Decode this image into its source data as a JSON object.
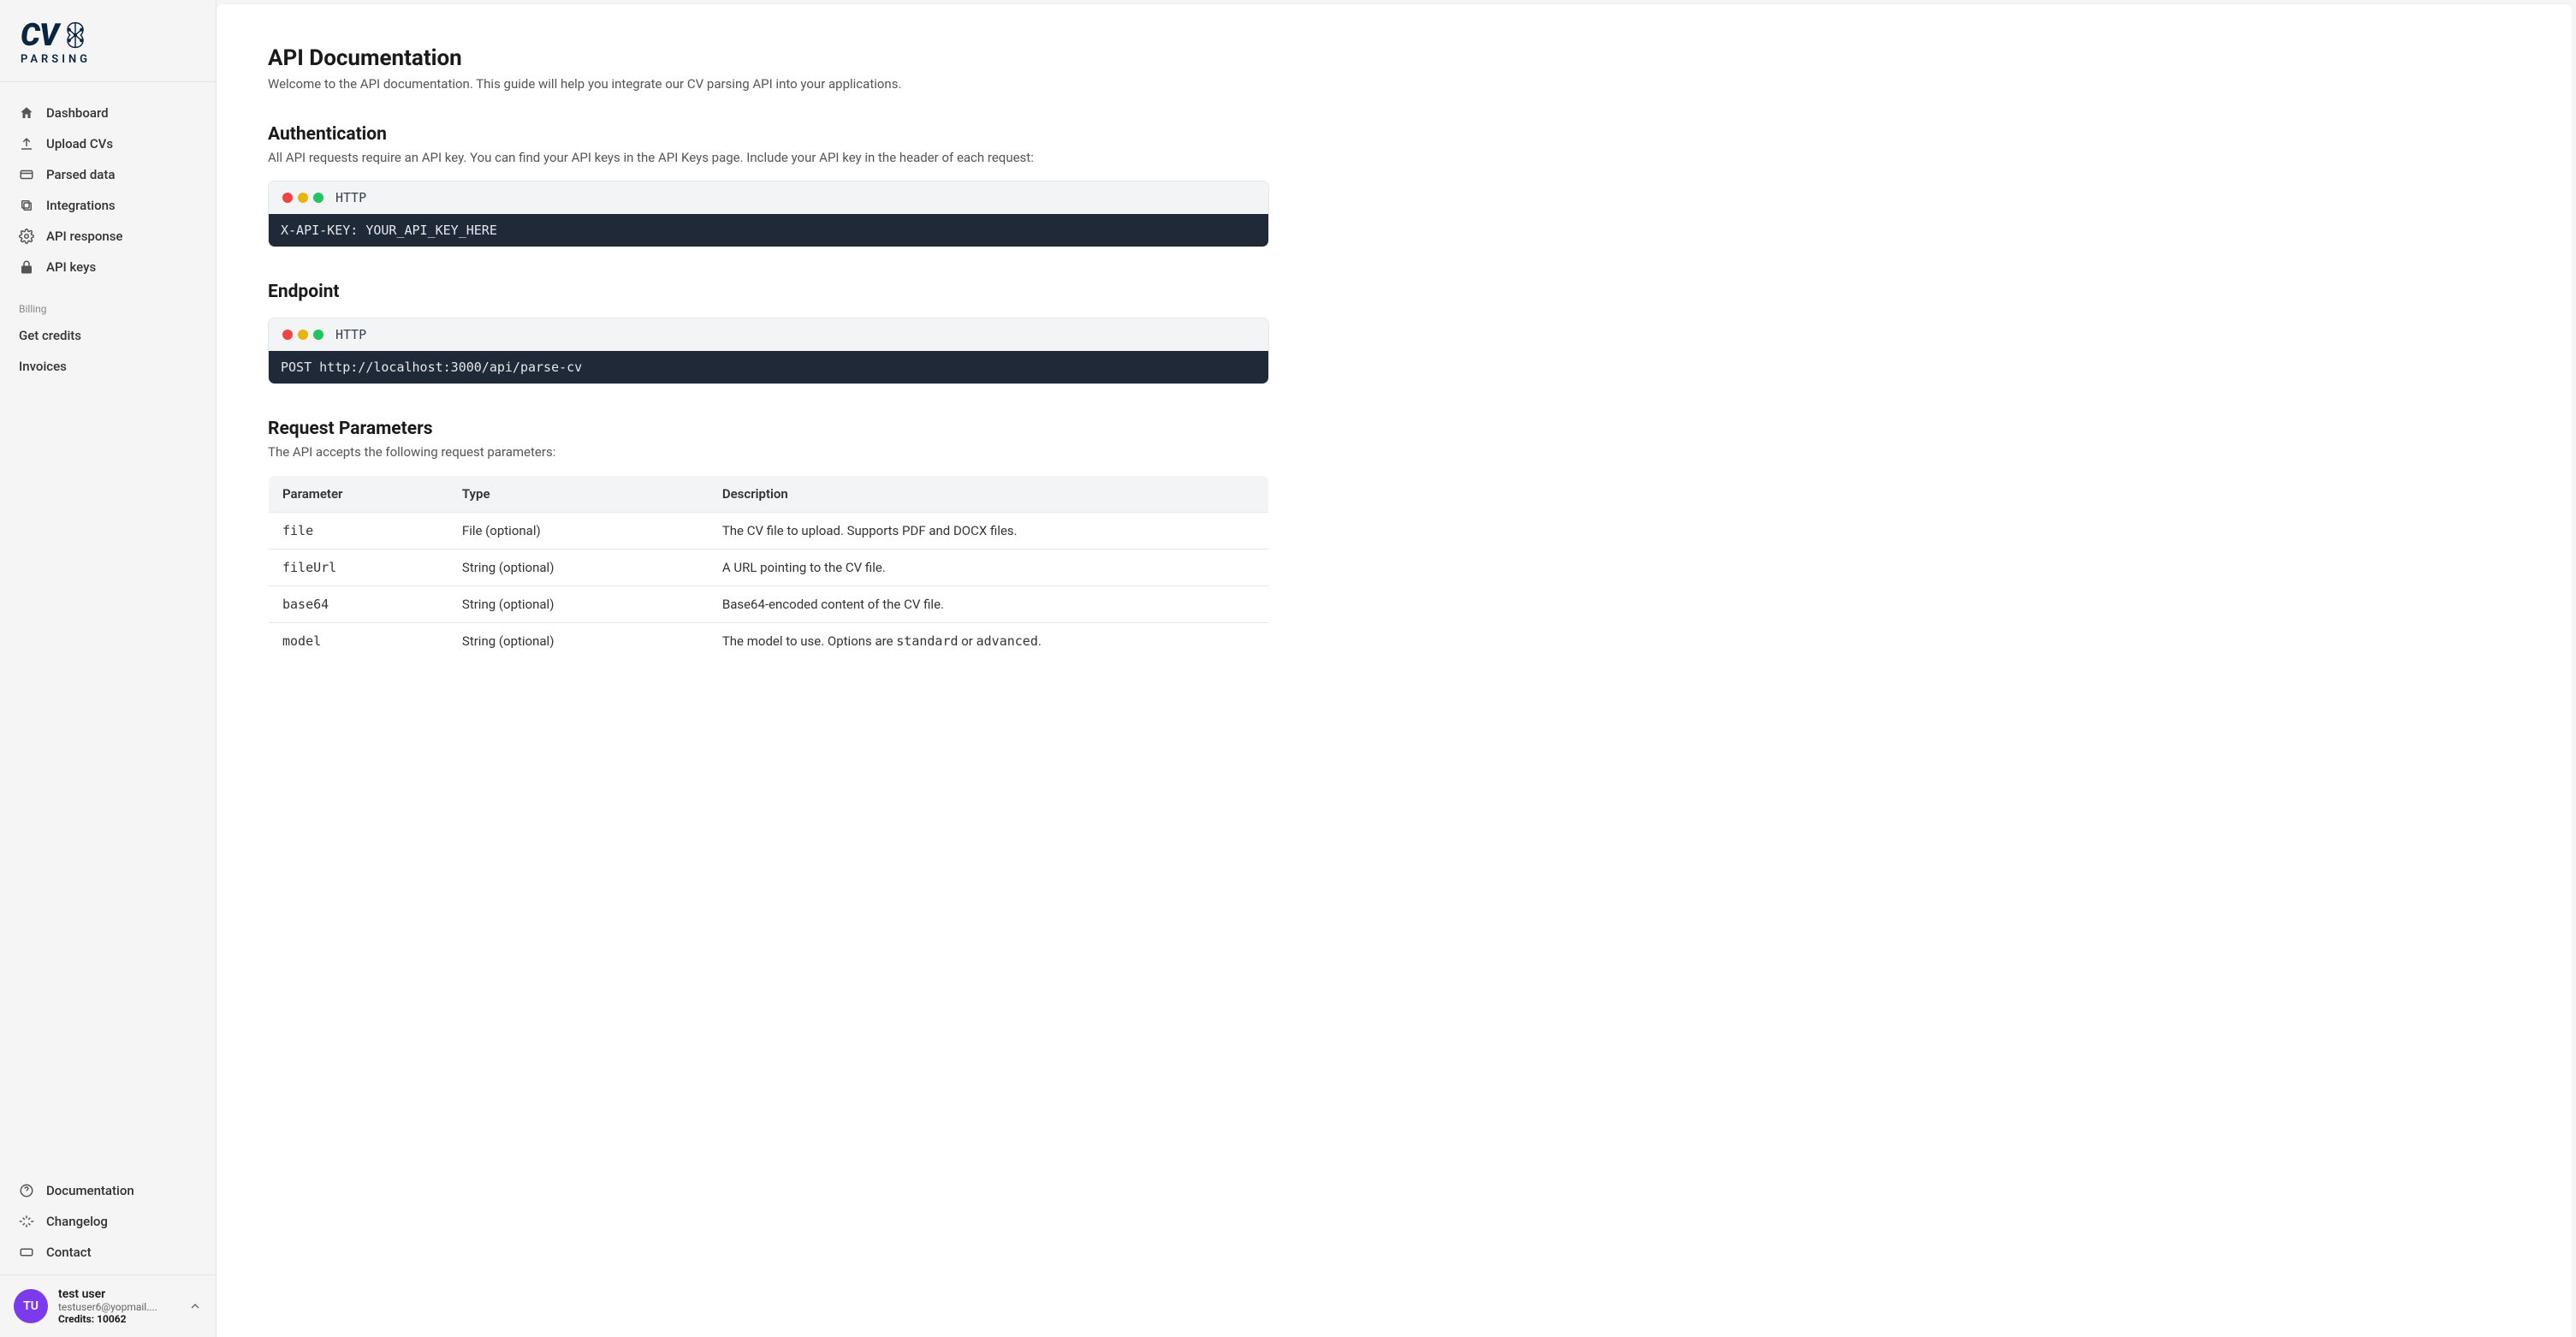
{
  "logo": {
    "top": "CV",
    "sub": "PARSING"
  },
  "sidebar": {
    "items": [
      {
        "label": "Dashboard",
        "icon": "home-icon"
      },
      {
        "label": "Upload CVs",
        "icon": "upload-icon"
      },
      {
        "label": "Parsed data",
        "icon": "card-icon"
      },
      {
        "label": "Integrations",
        "icon": "layers-icon"
      },
      {
        "label": "API response",
        "icon": "gear-icon"
      },
      {
        "label": "API keys",
        "icon": "lock-icon"
      }
    ],
    "billing_label": "Billing",
    "billing_items": [
      {
        "label": "Get credits"
      },
      {
        "label": "Invoices"
      }
    ],
    "bottom_items": [
      {
        "label": "Documentation",
        "icon": "help-icon"
      },
      {
        "label": "Changelog",
        "icon": "sparkle-icon"
      },
      {
        "label": "Contact",
        "icon": "ticket-icon"
      }
    ]
  },
  "user": {
    "initials": "TU",
    "name": "test user",
    "email": "testuser6@yopmail....",
    "credits_label": "Credits: 10062"
  },
  "page": {
    "title": "API Documentation",
    "subtitle": "Welcome to the API documentation. This guide will help you integrate our CV parsing API into your applications.",
    "auth": {
      "heading": "Authentication",
      "desc": "All API requests require an API key. You can find your API keys in the API Keys page. Include your API key in the header of each request:",
      "code_lang": "HTTP",
      "code": "X-API-KEY: YOUR_API_KEY_HERE"
    },
    "endpoint": {
      "heading": "Endpoint",
      "code_lang": "HTTP",
      "code": "POST http://localhost:3000/api/parse-cv"
    },
    "params": {
      "heading": "Request Parameters",
      "desc": "The API accepts the following request parameters:",
      "headers": {
        "param": "Parameter",
        "type": "Type",
        "desc": "Description"
      },
      "rows": [
        {
          "param": "file",
          "type": "File (optional)",
          "desc": "The CV file to upload. Supports PDF and DOCX files."
        },
        {
          "param": "fileUrl",
          "type": "String (optional)",
          "desc": "A URL pointing to the CV file."
        },
        {
          "param": "base64",
          "type": "String (optional)",
          "desc": "Base64-encoded content of the CV file."
        },
        {
          "param": "model",
          "type": "String (optional)",
          "desc_pre": "The model to use. Options are ",
          "opt1": "standard",
          "mid": " or ",
          "opt2": "advanced",
          "suffix": "."
        }
      ]
    }
  }
}
